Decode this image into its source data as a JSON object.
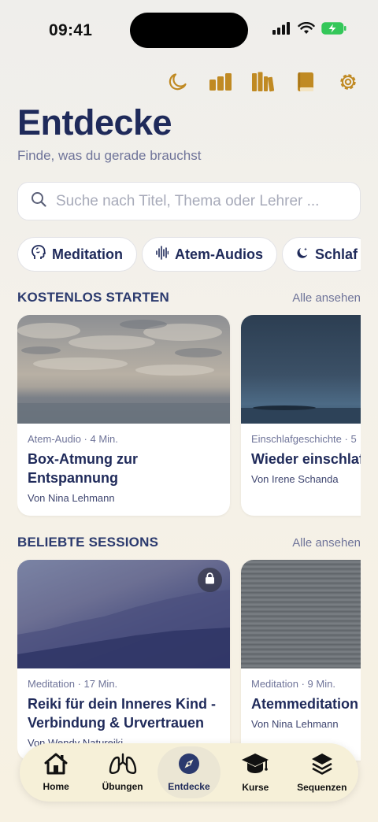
{
  "status": {
    "time": "09:41"
  },
  "colors": {
    "accent": "#c08a23",
    "navy": "#1f2a5a",
    "muted": "#6f7499"
  },
  "toolbar": {
    "icons": [
      "moon-icon",
      "stats-bars-icon",
      "library-icon",
      "book-icon",
      "gear-icon"
    ]
  },
  "header": {
    "title": "Entdecke",
    "subtitle": "Finde, was du gerade brauchst"
  },
  "search": {
    "placeholder": "Suche nach Titel, Thema oder Lehrer ..."
  },
  "categories": [
    {
      "label": "Meditation",
      "icon": "head-icon"
    },
    {
      "label": "Atem-Audios",
      "icon": "waveform-icon"
    },
    {
      "label": "Schlaf",
      "icon": "moon-stars-icon"
    }
  ],
  "sections": [
    {
      "title": "KOSTENLOS STARTEN",
      "see_all": "Alle ansehen",
      "cards": [
        {
          "meta": "Atem-Audio · 4 Min.",
          "title": "Box-Atmung zur Entspannung",
          "author": "Von Nina Lehmann",
          "locked": false
        },
        {
          "meta": "Einschlafgeschichte · 5",
          "title": "Wieder einschlafen",
          "author": "Von Irene Schanda",
          "locked": false
        }
      ]
    },
    {
      "title": "BELIEBTE SESSIONS",
      "see_all": "Alle ansehen",
      "cards": [
        {
          "meta": "Meditation · 17 Min.",
          "title": "Reiki für dein Inneres Kind - Verbindung & Urvertrauen",
          "author": "Von Wendy Natureiki",
          "locked": true
        },
        {
          "meta": "Meditation · 9 Min.",
          "title": "Atemmeditation Kohärenz",
          "author": "Von Nina Lehmann",
          "locked": false
        }
      ]
    }
  ],
  "tabbar": {
    "active": "Entdecke",
    "tabs": [
      {
        "label": "Home",
        "icon": "house-icon"
      },
      {
        "label": "Übungen",
        "icon": "lungs-icon"
      },
      {
        "label": "Entdecke",
        "icon": "compass-icon"
      },
      {
        "label": "Kurse",
        "icon": "graduation-cap-icon"
      },
      {
        "label": "Sequenzen",
        "icon": "stack-icon"
      }
    ]
  }
}
